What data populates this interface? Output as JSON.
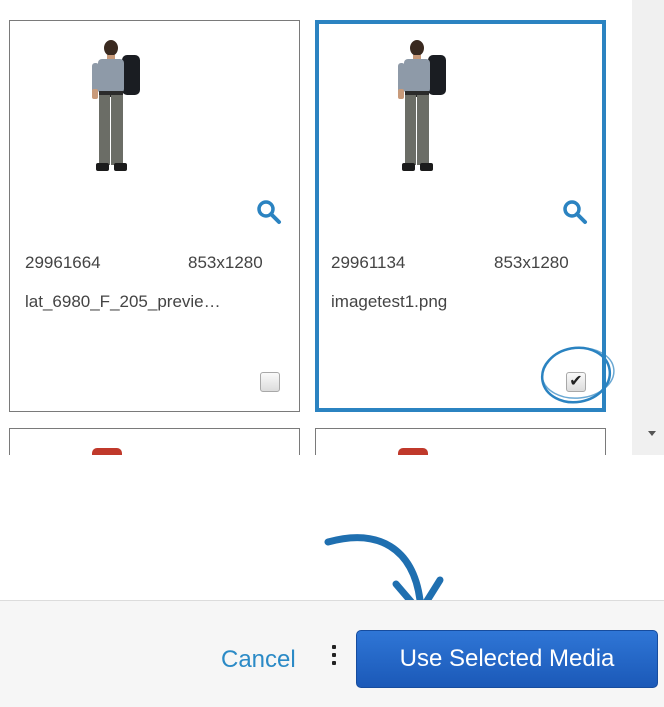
{
  "cards": [
    {
      "id": "29961664",
      "dimensions": "853x1280",
      "filename": "lat_6980_F_205_previe…",
      "selected": false
    },
    {
      "id": "29961134",
      "dimensions": "853x1280",
      "filename": "imagetest1.png",
      "selected": true
    }
  ],
  "footer": {
    "cancel_label": "Cancel",
    "use_selected_label": "Use Selected Media"
  },
  "colors": {
    "accent": "#2b83c1",
    "button": "#1f62c4",
    "link": "#2b8ac6"
  },
  "icons": [
    "zoom-icon",
    "checkbox-icon",
    "kebab-menu-icon",
    "scroll-down-arrow-icon"
  ]
}
